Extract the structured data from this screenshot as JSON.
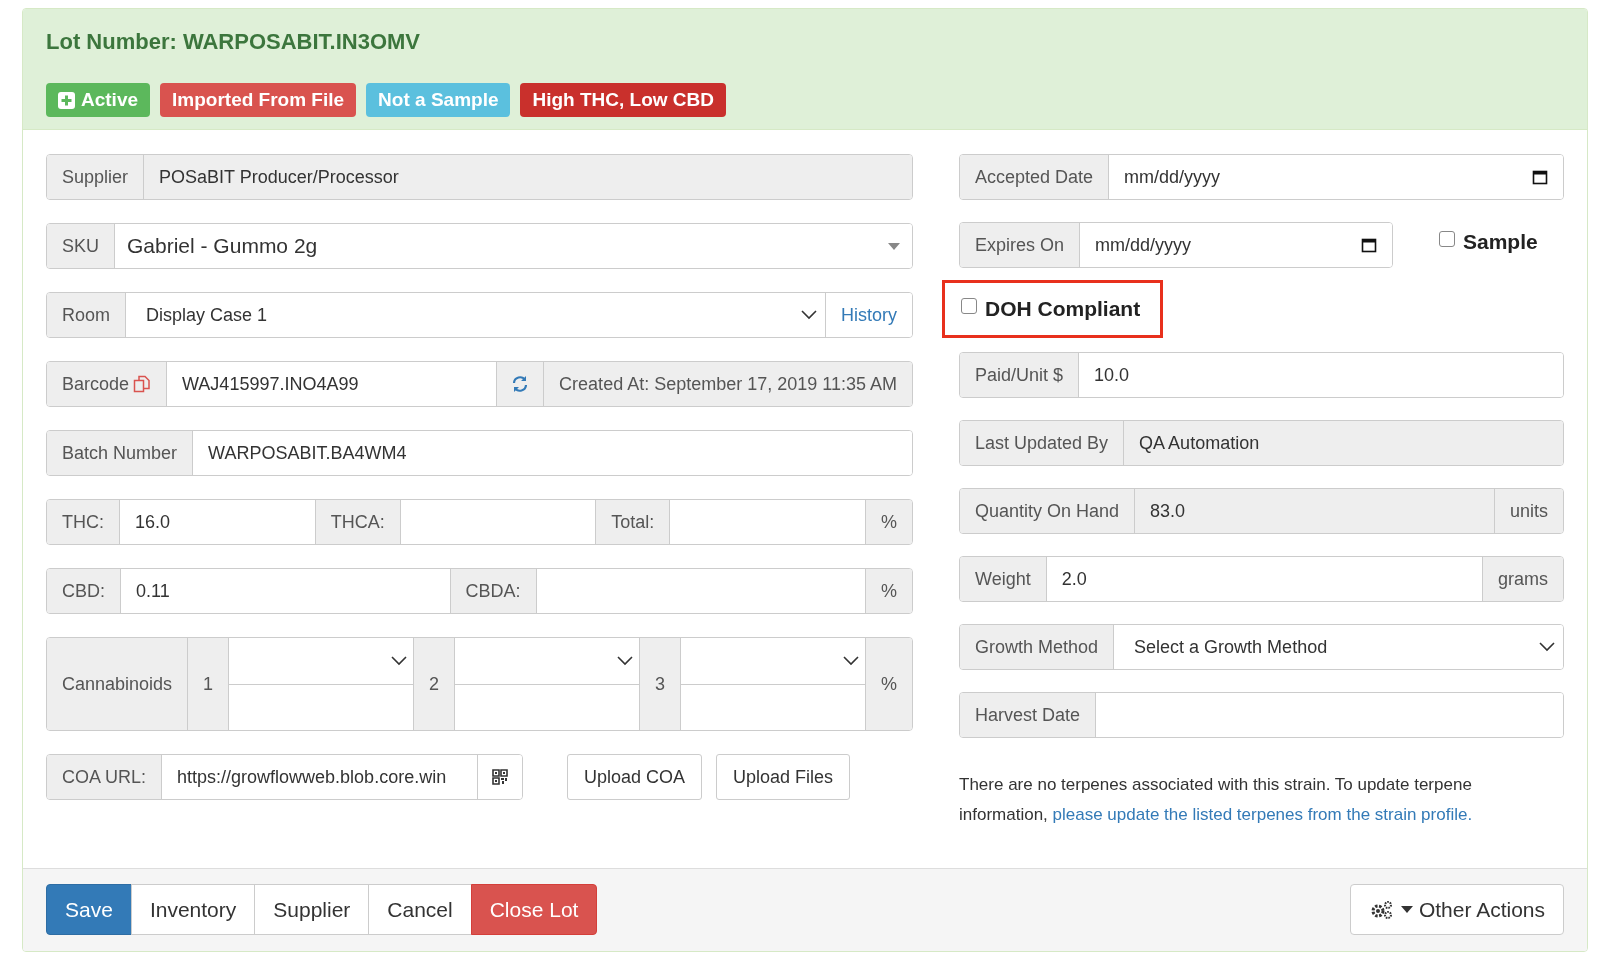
{
  "header": {
    "title": "Lot Number: WARPOSABIT.IN3OMV",
    "badges": [
      {
        "kind": "status",
        "text": "Active",
        "color": "#5cb85c"
      },
      {
        "kind": "label",
        "text": "Imported From File",
        "color": "#d9534f"
      },
      {
        "kind": "label",
        "text": "Not a Sample",
        "color": "#5bc0de"
      },
      {
        "kind": "label",
        "text": "High THC, Low CBD",
        "color": "#c9302c"
      }
    ]
  },
  "left_rows": [
    {
      "kind": "group",
      "parts": [
        {
          "kind": "addon",
          "text": "Supplier"
        },
        {
          "kind": "readonly",
          "value": "POSaBIT Producer/Processor"
        }
      ]
    },
    {
      "kind": "group",
      "parts": [
        {
          "kind": "addon",
          "text": "SKU"
        },
        {
          "kind": "combo",
          "value": "Gabriel - Gummo 2g"
        }
      ]
    },
    {
      "kind": "group",
      "parts": [
        {
          "kind": "addon",
          "text": "Room"
        },
        {
          "kind": "select",
          "value": "Display Case 1"
        },
        {
          "kind": "link-addon",
          "text": "History"
        }
      ]
    },
    {
      "kind": "group",
      "parts": [
        {
          "kind": "copy-addon",
          "text": "Barcode"
        },
        {
          "kind": "input",
          "value": "WAJ415997.INO4A99"
        },
        {
          "kind": "refresh-addon"
        },
        {
          "kind": "addon",
          "text": "Created At: September 17, 2019 11:35 AM"
        }
      ]
    },
    {
      "kind": "group",
      "parts": [
        {
          "kind": "addon",
          "text": "Batch Number"
        },
        {
          "kind": "input",
          "value": "WARPOSABIT.BA4WM4"
        }
      ]
    },
    {
      "kind": "group",
      "parts": [
        {
          "kind": "addon",
          "text": "THC:"
        },
        {
          "kind": "input",
          "value": "16.0"
        },
        {
          "kind": "addon",
          "text": "THCA:"
        },
        {
          "kind": "input"
        },
        {
          "kind": "addon",
          "text": "Total:"
        },
        {
          "kind": "input"
        },
        {
          "kind": "addon",
          "text": "%"
        }
      ]
    },
    {
      "kind": "group",
      "parts": [
        {
          "kind": "addon",
          "text": "CBD:"
        },
        {
          "kind": "input",
          "value": "0.11"
        },
        {
          "kind": "addon",
          "text": "CBDA:"
        },
        {
          "kind": "input"
        },
        {
          "kind": "addon",
          "text": "%"
        }
      ]
    },
    {
      "kind": "cannabinoids",
      "label": "Cannabinoids",
      "slots": [
        "1",
        "2",
        "3"
      ],
      "unit": "%"
    },
    {
      "kind": "coa",
      "parts": [
        {
          "kind": "addon",
          "text": "COA URL:"
        },
        {
          "kind": "input",
          "value": "https://growflowweb.blob.core.win"
        },
        {
          "kind": "qr-addon"
        }
      ],
      "buttons": [
        "Upload COA",
        "Upload Files"
      ]
    }
  ],
  "right_rows": [
    {
      "kind": "group",
      "parts": [
        {
          "kind": "addon",
          "text": "Accepted Date"
        },
        {
          "kind": "date",
          "placeholder": "mm/dd/yyyy"
        }
      ]
    },
    {
      "kind": "group-check",
      "parts": [
        {
          "kind": "addon",
          "text": "Expires On"
        },
        {
          "kind": "date",
          "placeholder": "mm/dd/yyyy"
        }
      ],
      "check": {
        "label": "Sample",
        "checked": false
      }
    },
    {
      "kind": "check",
      "label": "DOH Compliant",
      "checked": false,
      "highlighted": true
    },
    {
      "kind": "group",
      "parts": [
        {
          "kind": "addon",
          "text": "Paid/Unit $"
        },
        {
          "kind": "input",
          "value": "10.0"
        }
      ]
    },
    {
      "kind": "group",
      "parts": [
        {
          "kind": "addon",
          "text": "Last Updated By"
        },
        {
          "kind": "readonly",
          "value": "QA Automation"
        }
      ]
    },
    {
      "kind": "group",
      "parts": [
        {
          "kind": "addon",
          "text": "Quantity On Hand"
        },
        {
          "kind": "readonly",
          "value": "83.0"
        },
        {
          "kind": "addon",
          "text": "units"
        }
      ]
    },
    {
      "kind": "group",
      "parts": [
        {
          "kind": "addon",
          "text": "Weight"
        },
        {
          "kind": "input",
          "value": "2.0"
        },
        {
          "kind": "addon",
          "text": "grams"
        }
      ]
    },
    {
      "kind": "group",
      "parts": [
        {
          "kind": "addon",
          "text": "Growth Method"
        },
        {
          "kind": "select",
          "value": "Select a Growth Method"
        }
      ]
    },
    {
      "kind": "group",
      "parts": [
        {
          "kind": "addon",
          "text": "Harvest Date"
        },
        {
          "kind": "input"
        }
      ]
    },
    {
      "kind": "note",
      "text": "There are no terpenes associated with this strain. To update terpene information, ",
      "link": "please update the listed terpenes from the strain profile."
    }
  ],
  "footer": {
    "buttons": [
      {
        "text": "Save",
        "kind": "primary"
      },
      {
        "text": "Inventory",
        "kind": "default"
      },
      {
        "text": "Supplier",
        "kind": "default"
      },
      {
        "text": "Cancel",
        "kind": "default"
      },
      {
        "text": "Close Lot",
        "kind": "danger"
      }
    ],
    "menu": {
      "text": "Other Actions"
    }
  }
}
